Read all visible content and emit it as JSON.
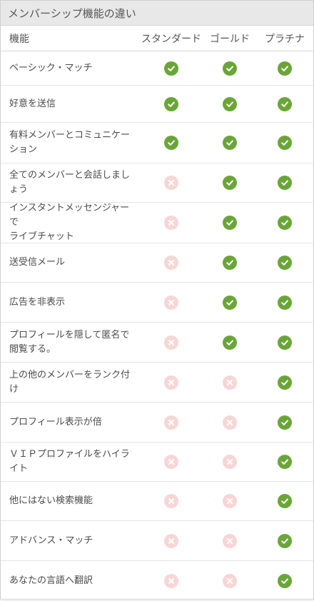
{
  "title": "メンバーシップ機能の違い",
  "columns": {
    "feature": "機能",
    "standard": "スタンダード",
    "gold": "ゴールド",
    "platinum": "プラチナ"
  },
  "colors": {
    "check": "#6aa637",
    "cross": "#f7d6d6",
    "header_bg": "#e8e8e8"
  },
  "rows": [
    {
      "feature": "ベーシック・マッチ",
      "standard": true,
      "gold": true,
      "platinum": true
    },
    {
      "feature": "好意を送信",
      "standard": true,
      "gold": true,
      "platinum": true
    },
    {
      "feature": "有料メンバーとコミュニケーション",
      "standard": true,
      "gold": true,
      "platinum": true
    },
    {
      "feature": "全てのメンバーと会話しましょう",
      "standard": false,
      "gold": true,
      "platinum": true
    },
    {
      "feature": "インスタントメッセンジャーで\nライブチャット",
      "standard": false,
      "gold": true,
      "platinum": true
    },
    {
      "feature": "送受信メール",
      "standard": false,
      "gold": true,
      "platinum": true
    },
    {
      "feature": "広告を非表示",
      "standard": false,
      "gold": true,
      "platinum": true
    },
    {
      "feature": "プロフィールを隠して匿名で\n閲覧する。",
      "standard": false,
      "gold": true,
      "platinum": true
    },
    {
      "feature": "上の他のメンバーをランク付け",
      "standard": false,
      "gold": false,
      "platinum": true
    },
    {
      "feature": "プロフィール表示が倍",
      "standard": false,
      "gold": false,
      "platinum": true
    },
    {
      "feature": "ＶＩＰプロファイルをハイライト",
      "standard": false,
      "gold": false,
      "platinum": true
    },
    {
      "feature": "他にはない検索機能",
      "standard": false,
      "gold": false,
      "platinum": true
    },
    {
      "feature": "アドバンス・マッチ",
      "standard": false,
      "gold": false,
      "platinum": true
    },
    {
      "feature": "あなたの言語へ翻訳",
      "standard": false,
      "gold": false,
      "platinum": true
    }
  ]
}
